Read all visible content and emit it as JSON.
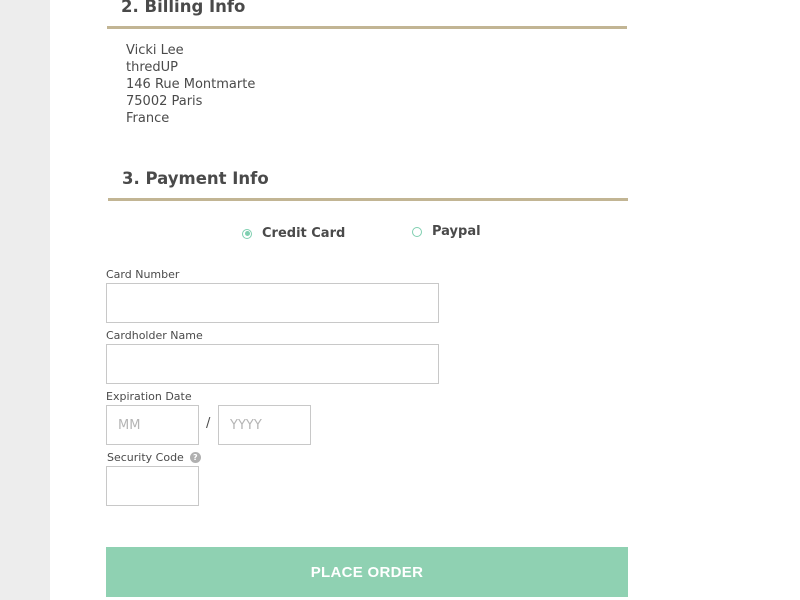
{
  "billing": {
    "title": "2. Billing Info",
    "address": [
      "Vicki Lee",
      "thredUP",
      "146 Rue Montmarte",
      "75002 Paris",
      "France"
    ]
  },
  "payment": {
    "title": "3. Payment Info",
    "methods": [
      {
        "label": "Credit Card",
        "selected": true
      },
      {
        "label": "Paypal",
        "selected": false
      }
    ],
    "fields": {
      "card_number_label": "Card Number",
      "cardholder_label": "Cardholder Name",
      "expiration_label": "Expiration Date",
      "exp_month_placeholder": "MM",
      "exp_separator": "/",
      "exp_year_placeholder": "YYYY",
      "security_code_label": "Security Code",
      "help_icon_glyph": "?"
    },
    "submit_label": "PLACE ORDER"
  },
  "colors": {
    "accent": "#8fd1b2",
    "rule": "#c2b594",
    "sidebar": "#ededed"
  }
}
